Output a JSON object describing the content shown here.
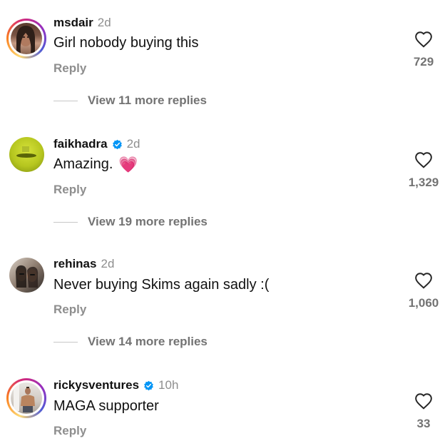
{
  "comments": [
    {
      "username": "msdair",
      "time": "2d",
      "text": "Girl nobody buying this",
      "reply_label": "Reply",
      "likes": "729",
      "view_more": "View 11 more replies",
      "verified": false,
      "story_ring": true
    },
    {
      "username": "faikhadra",
      "time": "2d",
      "text": "Amazing.",
      "emoji": "💗",
      "reply_label": "Reply",
      "likes": "1,329",
      "view_more": "View 19 more replies",
      "verified": true,
      "story_ring": false
    },
    {
      "username": "rehinas",
      "time": "2d",
      "text": "Never buying Skims again sadly :(",
      "reply_label": "Reply",
      "likes": "1,060",
      "view_more": "View 14 more replies",
      "verified": false,
      "story_ring": false
    },
    {
      "username": "rickysventures",
      "time": "10h",
      "text": "MAGA supporter",
      "reply_label": "Reply",
      "likes": "33",
      "verified": true,
      "story_ring": true
    }
  ],
  "colors": {
    "verified_blue": "#0095f6",
    "muted_text": "#8e8e8e",
    "heart_stroke": "#262626"
  }
}
